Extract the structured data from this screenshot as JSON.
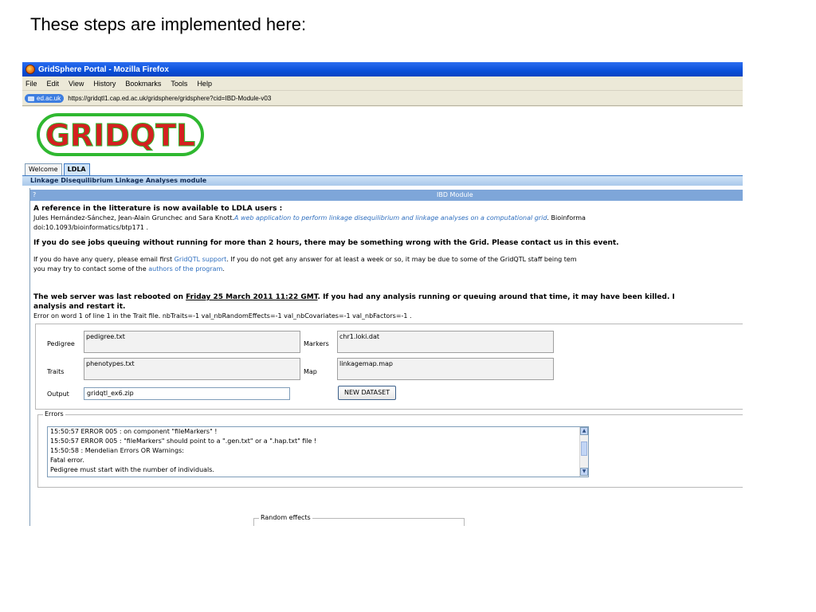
{
  "slide_title": "These steps are implemented here:",
  "window": {
    "title": "GridSphere Portal - Mozilla Firefox"
  },
  "menu": [
    "File",
    "Edit",
    "View",
    "History",
    "Bookmarks",
    "Tools",
    "Help"
  ],
  "urlbar": {
    "site": "ed.ac.uk",
    "url": "https://gridqtl1.cap.ed.ac.uk/gridsphere/gridsphere?cid=IBD-Module-v03"
  },
  "logo": {
    "text": "GRIDQTL"
  },
  "tabs": [
    {
      "label": "Welcome",
      "active": false
    },
    {
      "label": "LDLA",
      "active": true
    }
  ],
  "module_title": "Linkage Disequilibrium Linkage Analyses module",
  "ibd": {
    "help": "?",
    "title": "IBD Module"
  },
  "notice": {
    "ref_heading": "A reference in the litterature is now available to LDLA users :",
    "ref_authors": "Jules Hernández-Sánchez, Jean-Alain Grunchec and Sara Knott.",
    "ref_title": "A web application to perform linkage disequilibrium and linkage analyses on a computational grid",
    "ref_journal": ". Bioinforma",
    "ref_doi": "doi:10.1093/bioinformatics/btp171 .",
    "queue_warning": "If you do see jobs queuing without running for more than 2 hours, there may be something wrong with the Grid. Please contact us in this event.",
    "query_a": "If you do have any query, please email first ",
    "support_link": "GridQTL support",
    "query_b": ". If you do not get any answer for at least a week or so, it may be due to some of the GridQTL staff being tem",
    "query_c": "you may try to contact some of the ",
    "authors_link": "authors of the program",
    "query_d": ".",
    "reboot_a": "The web server was last rebooted on ",
    "reboot_date": "Friday 25 March 2011 11:22 GMT",
    "reboot_b": ". If you had any analysis running or queuing around that time, it may have been killed. I",
    "reboot_c": "analysis and restart it.",
    "error_line": "Error on word 1 of line 1 in the Trait file. nbTraits=-1 val_nbRandomEffects=-1 val_nbCovariates=-1 val_nbFactors=-1 ."
  },
  "form": {
    "pedigree_label": "Pedigree",
    "pedigree_value": "pedigree.txt",
    "markers_label": "Markers",
    "markers_value": "chr1.loki.dat",
    "traits_label": "Traits",
    "traits_value": "phenotypes.txt",
    "map_label": "Map",
    "map_value": "linkagemap.map",
    "output_label": "Output",
    "output_value": "gridqtl_ex6.zip",
    "new_dataset": "NEW DATASET"
  },
  "errors": {
    "legend": "Errors",
    "lines": [
      "15:50:57 ERROR 005 : on component \"fileMarkers\" !",
      "15:50:57 ERROR 005 : \"fileMarkers\" should point to a \".gen.txt\" or a \".hap.txt\" file !",
      "15:50:58 : Mendelian Errors OR Warnings:",
      "Fatal error.",
      "Pedigree must start with the number of individuals."
    ]
  },
  "random_effects": {
    "legend": "Random effects"
  },
  "colors": {
    "titlebar": "#0a4fd9",
    "module_bar": "#a9c8ea",
    "ibd_bar": "#7ea6d9",
    "link": "#2f6fbf",
    "logo_red": "#d42020",
    "logo_green": "#2fb830"
  }
}
